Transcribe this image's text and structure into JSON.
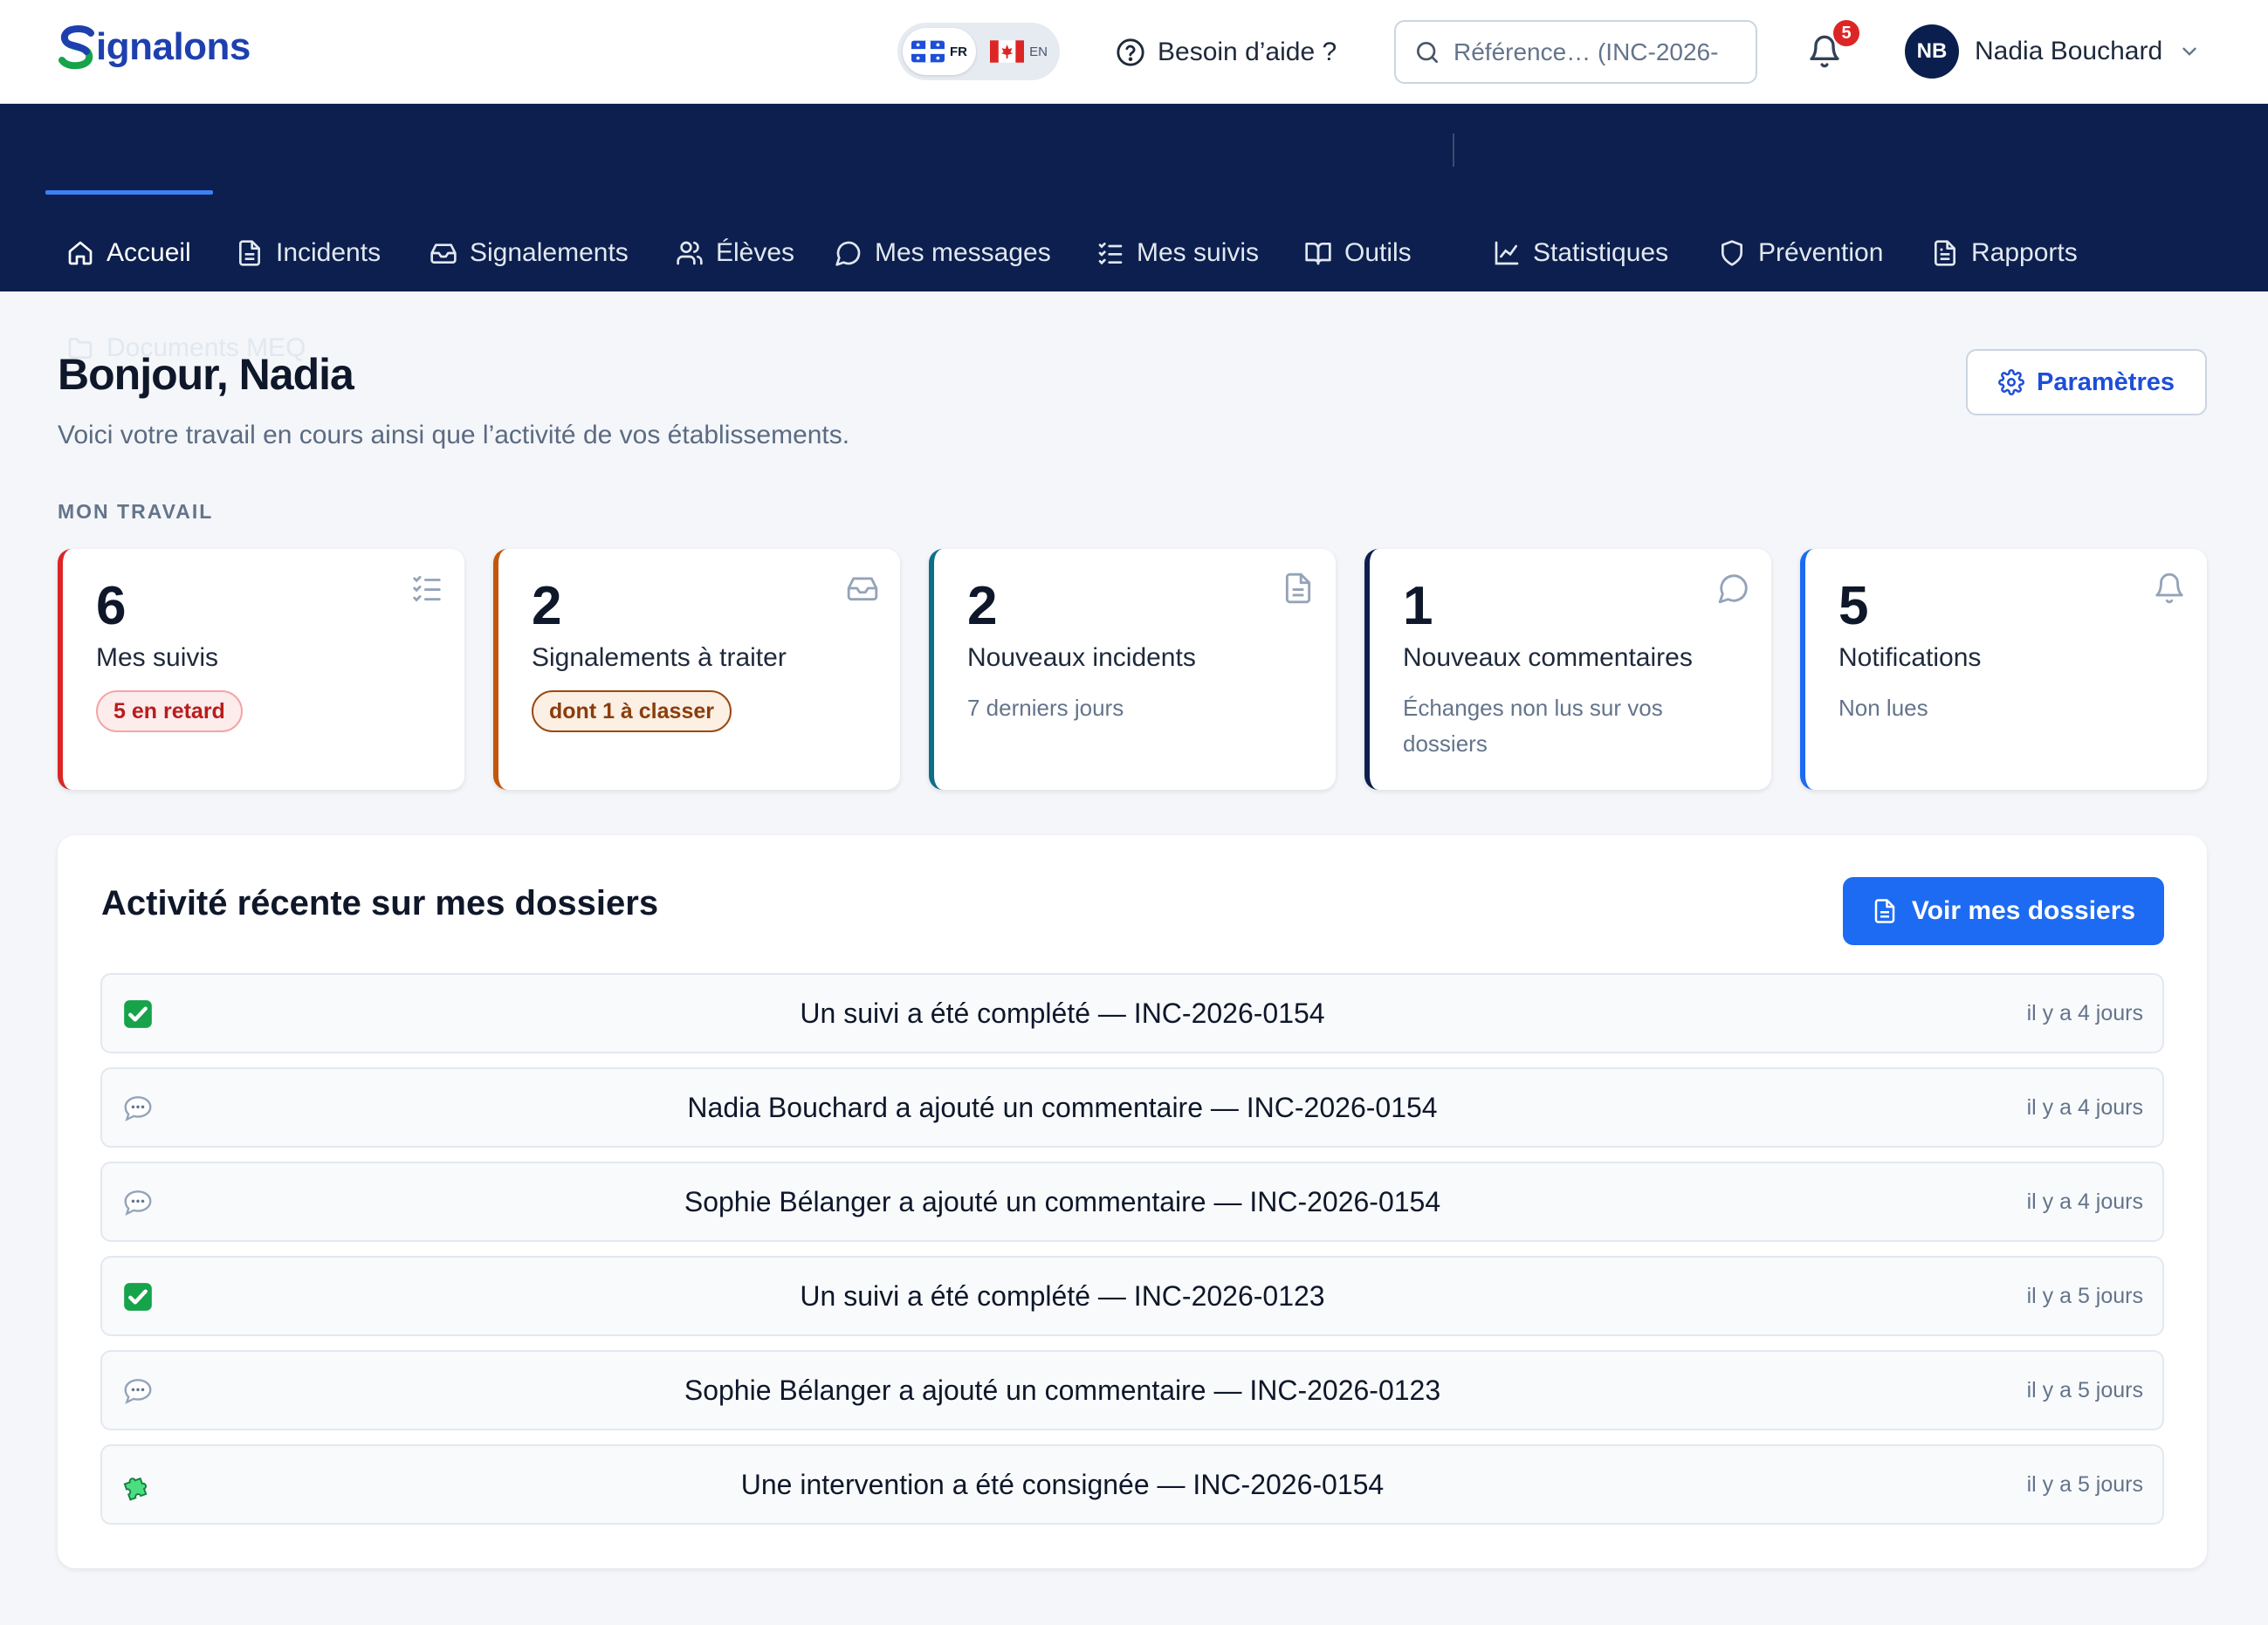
{
  "app": {
    "logo_text": "ignalons"
  },
  "language": {
    "fr_code": "FR",
    "en_code": "EN"
  },
  "header": {
    "help_label": "Besoin d’aide ?",
    "search_placeholder": "Référence… (INC-2026-",
    "notifications_count": "5",
    "user_initials": "NB",
    "user_name": "Nadia Bouchard"
  },
  "nav": {
    "items": [
      {
        "label": "Accueil",
        "icon": "home-icon"
      },
      {
        "label": "Incidents",
        "icon": "document-icon"
      },
      {
        "label": "Signalements",
        "icon": "inbox-icon"
      },
      {
        "label": "Élèves",
        "icon": "users-icon"
      },
      {
        "label": "Mes messages",
        "icon": "message-icon"
      },
      {
        "label": "Mes suivis",
        "icon": "checklist-icon"
      },
      {
        "label": "Outils",
        "icon": "book-icon"
      },
      {
        "label": "Statistiques",
        "icon": "chart-icon"
      },
      {
        "label": "Prévention",
        "icon": "shield-icon"
      },
      {
        "label": "Rapports",
        "icon": "report-icon"
      },
      {
        "label": "Documents MEQ",
        "icon": "folder-icon"
      }
    ]
  },
  "page": {
    "greeting": "Bonjour, Nadia",
    "subtitle": "Voici votre travail en cours ainsi que l’activité de vos établissements.",
    "settings_label": "Paramètres",
    "section_label": "MON TRAVAIL"
  },
  "cards": [
    {
      "value": "6",
      "title": "Mes suivis",
      "badge": "5 en retard",
      "accent": "#dc2626",
      "icon": "checklist-icon"
    },
    {
      "value": "2",
      "title": "Signalements à traiter",
      "badge": "dont 1 à classer",
      "accent": "#c2570c",
      "icon": "inbox-icon"
    },
    {
      "value": "2",
      "title": "Nouveaux incidents",
      "subtitle": "7 derniers jours",
      "accent": "#0e6e8a",
      "icon": "document-icon"
    },
    {
      "value": "1",
      "title": "Nouveaux commentaires",
      "subtitle": "Échanges non lus sur vos dossiers",
      "accent": "#0c1f4e",
      "icon": "message-icon"
    },
    {
      "value": "5",
      "title": "Notifications",
      "subtitle": "Non lues",
      "accent": "#1d6bf2",
      "icon": "bell-icon"
    }
  ],
  "activity": {
    "title": "Activité récente sur mes dossiers",
    "button_label": "Voir mes dossiers",
    "items": [
      {
        "icon": "check-icon",
        "text": "Un suivi a été complété — INC-2026-0154",
        "time": "il y a 4 jours"
      },
      {
        "icon": "speech-bubble-icon",
        "text": "Nadia Bouchard a ajouté un commentaire — INC-2026-0154",
        "time": "il y a 4 jours"
      },
      {
        "icon": "speech-bubble-icon",
        "text": "Sophie Bélanger a ajouté un commentaire — INC-2026-0154",
        "time": "il y a 4 jours"
      },
      {
        "icon": "check-icon",
        "text": "Un suivi a été complété — INC-2026-0123",
        "time": "il y a 5 jours"
      },
      {
        "icon": "speech-bubble-icon",
        "text": "Sophie Bélanger a ajouté un commentaire — INC-2026-0123",
        "time": "il y a 5 jours"
      },
      {
        "icon": "puzzle-icon",
        "text": "Une intervention a été consignée — INC-2026-0154",
        "time": "il y a 5 jours"
      }
    ]
  },
  "colors": {
    "brand": "#1e40af",
    "nav_bg": "#0c1f4e",
    "primary": "#1d6bf2",
    "danger": "#dc2626",
    "warning": "#c2570c"
  }
}
